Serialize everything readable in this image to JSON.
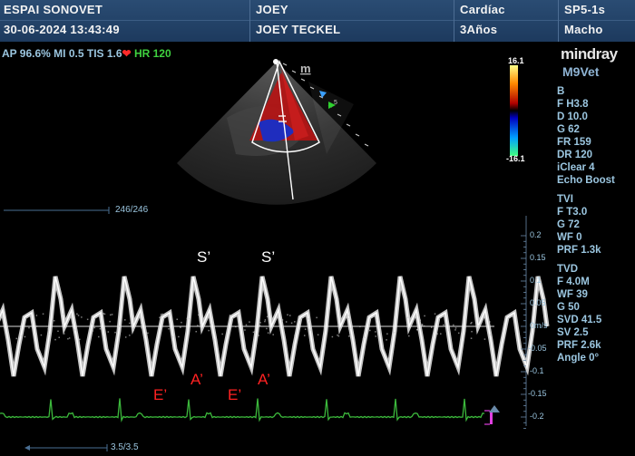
{
  "header": {
    "clinic": "ESPAI SONOVET",
    "datetime": "30-06-2024 13:43:49",
    "patient_id": "JOEY",
    "patient_name": "JOEY TECKEL",
    "exam": "Cardíac",
    "age": "3Años",
    "probe": "SP5-1s",
    "sex": "Macho"
  },
  "acoustics": {
    "ap": "AP 96.6%",
    "mi": "MI 0.5",
    "tis": "TIS 1.6",
    "heart_icon": "heart-icon",
    "hr": "HR 120"
  },
  "brand": {
    "logo": "mindray",
    "model": "M9Vet"
  },
  "params_b": [
    "B",
    "F H3.8",
    "D 10.0",
    "G 62",
    "FR 159",
    "DR 120",
    "iClear 4",
    "Echo Boost"
  ],
  "params_tvi": [
    "TVI",
    "F T3.0",
    "G 72",
    "WF 0",
    "PRF 1.3k"
  ],
  "params_tvd": [
    "TVD",
    "F 4.0M",
    "WF 39",
    "G 50",
    "SVD 41.5",
    "SV 2.5",
    "PRF 2.6k",
    "Angle 0°"
  ],
  "color_bar": {
    "max": "16.1",
    "min": "-16.1"
  },
  "sector": {
    "marker": "m",
    "focus_label": "5"
  },
  "cine": {
    "top_counter": "246/246",
    "bottom_counter": "3.5/3.5"
  },
  "doppler_scale": [
    "0.2",
    "0.15",
    "0.1",
    "0.05",
    "0m/s",
    "-0.05",
    "-0.1",
    "-0.15",
    "-0.2"
  ],
  "annotations": {
    "s1": "S’",
    "s2": "S’",
    "e1": "E’",
    "a1": "A’",
    "e2": "E’",
    "a2": "A’"
  },
  "colors": {
    "header_bg": "#1d3a5e",
    "param_text": "#9bc6e0",
    "ecg": "#3cb93c",
    "hr_green": "#3fd13f",
    "annotation_red": "#ff2222"
  }
}
